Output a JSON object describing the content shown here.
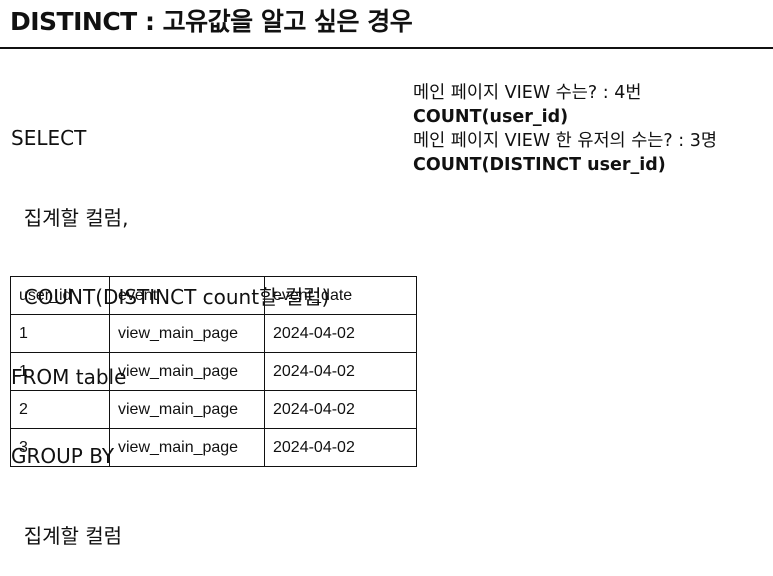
{
  "title": "DISTINCT : 고유값을 알고 싶은 경우",
  "sql_lines": [
    "SELECT",
    "  집계할 컬럼,",
    "  COUNT(DISTINCT count할-컬럼)",
    "FROM table",
    "GROUP BY",
    "  집계할 컬럼"
  ],
  "notes": [
    {
      "text": "메인 페이지 VIEW 수는? :  4번",
      "bold": false
    },
    {
      "text": "COUNT(user_id)",
      "bold": true
    },
    {
      "text": "메인 페이지 VIEW 한 유저의 수는? : 3명",
      "bold": false
    },
    {
      "text": "COUNT(DISTINCT user_id)",
      "bold": true
    }
  ],
  "table": {
    "headers": [
      "user_id",
      "event",
      "event_date"
    ],
    "rows": [
      [
        "1",
        "view_main_page",
        "2024-04-02"
      ],
      [
        "1",
        "view_main_page",
        "2024-04-02"
      ],
      [
        "2",
        "view_main_page",
        "2024-04-02"
      ],
      [
        "3",
        "view_main_page",
        "2024-04-02"
      ]
    ]
  }
}
